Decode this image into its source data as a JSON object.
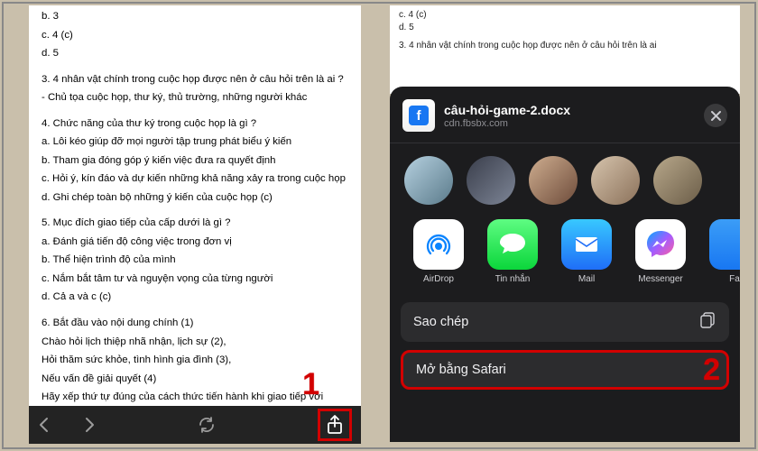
{
  "left": {
    "lines": {
      "b": "b. 3",
      "c": "c. 4 (c)",
      "d": "d. 5",
      "q3": "3. 4 nhân vật chính trong cuộc họp được nên ở câu hỏi trên là ai ?",
      "a3": "- Chủ tọa cuộc họp, thư ký, thủ trường, những người khác",
      "q4": "4. Chức năng của thư ký trong cuộc họp là gì ?",
      "q4a": "a. Lôi kéo giúp đỡ mọi người tập trung phát biểu ý kiến",
      "q4b": "b. Tham gia đóng góp ý kiến việc đưa ra quyết định",
      "q4c": "c. Hỏi ý, kín đáo và dự kiến những khả năng xảy ra trong cuộc họp",
      "q4d": "d. Ghi chép toàn bộ những ý kiến của cuộc họp (c)",
      "q5": "5. Mục đích giao tiếp của cấp dưới là gì ?",
      "q5a": "a. Đánh giá tiến độ công việc trong đơn vị",
      "q5b": "b. Thể hiện trình độ của mình",
      "q5c": "c. Nắm bắt tâm tư và nguyện vọng của từng người",
      "q5d": "d. Cả a và c (c)",
      "q6": "6. Bắt đầu vào nội dung chính (1)",
      "q6a": "Chào hỏi lịch thiệp nhã nhận, lịch sự (2),",
      "q6b": "Hỏi thăm sức khỏe, tình hình gia đình (3),",
      "q6c": "Nếu vấn đề giải quyết (4)",
      "q6d": "Hãy xếp thứ tự đúng của cách thức tiến hành khi giao tiếp với"
    }
  },
  "right": {
    "doc_lines": {
      "c": "c. 4 (c)",
      "d": "d. 5",
      "q3": "3. 4 nhân vật chính trong cuộc họp được nên ở câu hỏi trên là ai"
    }
  },
  "sheet": {
    "filename": "câu-hỏi-game-2.docx",
    "source": "cdn.fbsbx.com",
    "apps": {
      "airdrop": "AirDrop",
      "messages": "Tin nhắn",
      "mail": "Mail",
      "messenger": "Messenger",
      "facebook": "Fa"
    },
    "actions": {
      "copy": "Sao chép",
      "safari": "Mở bằng Safari"
    }
  },
  "callouts": {
    "one": "1",
    "two": "2"
  }
}
